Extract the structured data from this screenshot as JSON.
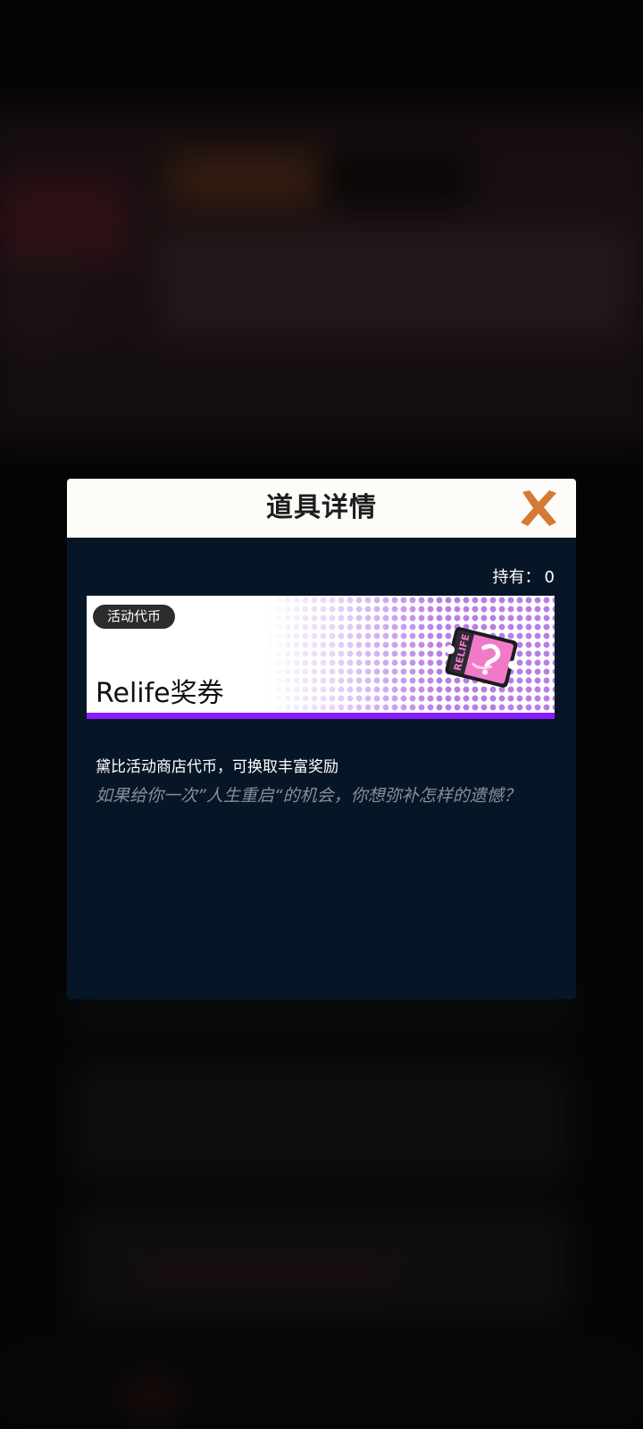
{
  "dialog": {
    "title": "道具详情",
    "owned_label": "持有：",
    "owned_value": "0"
  },
  "item": {
    "category": "活动代币",
    "name": "Relife奖券",
    "stars": "★★★★",
    "rarity_color": "#8a1aff",
    "description": "黛比活动商店代币，可换取丰富奖励",
    "flavor_text": "如果给你一次”人生重启“的机会，你想弥补怎样的遗憾？",
    "icon": "relife-ticket-icon",
    "icon_text": "RELIFE"
  },
  "colors": {
    "close_icon": "#d47a36",
    "dialog_body": "#061626",
    "header_bg": "#fdfcf8"
  }
}
